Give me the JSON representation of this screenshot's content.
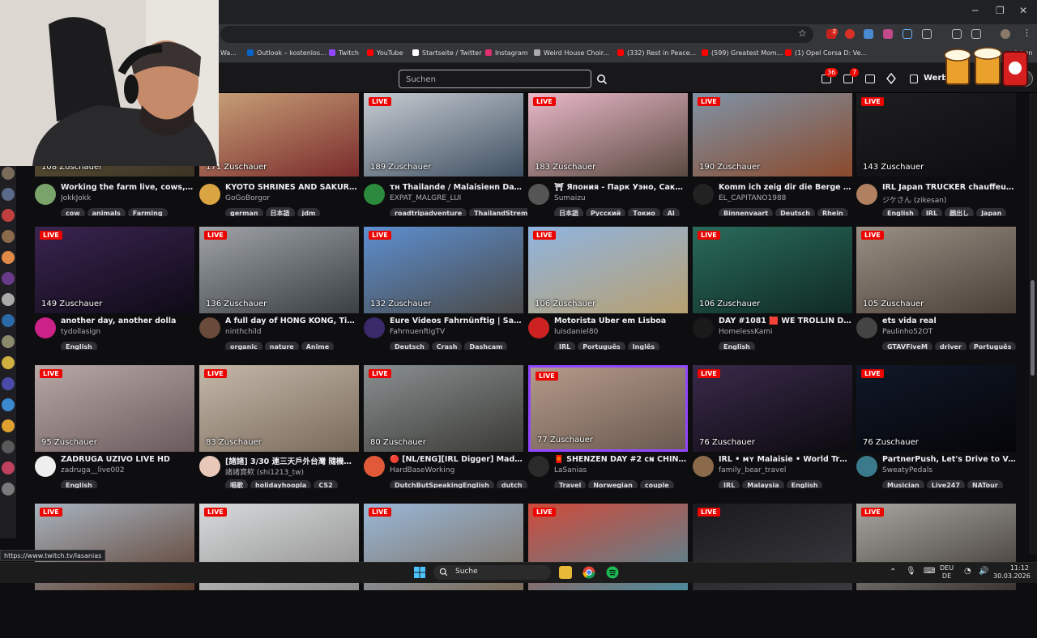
{
  "bookmarks": [
    {
      "label": "Wa...",
      "color": "#888888"
    },
    {
      "label": "Outlook – kostenlos...",
      "color": "#0a64c8"
    },
    {
      "label": "Twitch",
      "color": "#9147ff"
    },
    {
      "label": "YouTube",
      "color": "#ff0000"
    },
    {
      "label": "Startseite / Twitter",
      "color": "#ffffff"
    },
    {
      "label": "Instagram",
      "color": "#e1306c"
    },
    {
      "label": "Weird House Choir...",
      "color": "#aaaaaa"
    },
    {
      "label": "(332) Rest in Peace...",
      "color": "#ff0000"
    },
    {
      "label": "(599) Greatest Mom...",
      "color": "#ff0000"
    },
    {
      "label": "(1) Opel Corsa D: Ve...",
      "color": "#ff0000"
    },
    {
      "label": "...zeichen",
      "color": "#dcdcdc"
    }
  ],
  "extensions": {
    "badge1": "2",
    "badge2": ""
  },
  "topnav": {
    "search_placeholder": "Suchen",
    "notif_count_1": "36",
    "notif_count_2": "7",
    "werbung_label": "Werb"
  },
  "streams": [
    {
      "live": "",
      "viewers": "108 Zuschauer",
      "title": "Working the farm live, cows, shee...",
      "channel": "JokkJokk",
      "tags": [
        "cow",
        "animals",
        "Farming"
      ],
      "thumb": [
        "#6b6040",
        "#3c3324"
      ],
      "avatar": "#7aa36b"
    },
    {
      "live": "",
      "viewers": "171 Zuschauer",
      "title": "KYOTO SHRINES AND SAKURA | It...",
      "channel": "GoGoBorgor",
      "tags": [
        "german",
        "日本語",
        "jdm"
      ],
      "thumb": [
        "#c9a37a",
        "#7a2b2b"
      ],
      "avatar": "#d9a441"
    },
    {
      "live": "LIVE",
      "viewers": "189 Zuschauer",
      "title": "τн Thailande / Malaisieнn Day 12th ...",
      "channel": "EXPAT_MALGRE_LUI",
      "tags": [
        "roadtripadventure",
        "ThailandStremer"
      ],
      "thumb": [
        "#c7ccd2",
        "#3e4f61"
      ],
      "avatar": "#2b8a3e"
    },
    {
      "live": "LIVE",
      "viewers": "183 Zuschauer",
      "title": "⛩ Япония - Парк Уэно, Сакура, ...",
      "channel": "Sumaizu",
      "tags": [
        "日本語",
        "Русский",
        "Токио",
        "AI"
      ],
      "thumb": [
        "#e9b9c9",
        "#5a4a40"
      ],
      "avatar": "#555555"
    },
    {
      "live": "LIVE",
      "viewers": "190 Zuschauer",
      "title": "Komm ich zeig dir die Berge // !me...",
      "channel": "EL_CAPITANO1988",
      "tags": [
        "Binnenvaart",
        "Deutsch",
        "Rhein"
      ],
      "thumb": [
        "#7f93a6",
        "#8a4a2c"
      ],
      "avatar": "#222222"
    },
    {
      "live": "LIVE",
      "viewers": "143 Zuschauer",
      "title": "IRL Japan TRUCKER chauffeur de ...",
      "channel": "ジケさん (zikesan)",
      "tags": [
        "English",
        "IRL",
        "顔出し",
        "Japan"
      ],
      "thumb": [
        "#1e1e20",
        "#0d0d0f"
      ],
      "avatar": "#b08060"
    },
    {
      "live": "LIVE",
      "viewers": "149 Zuschauer",
      "title": "another day, another dolla",
      "channel": "tydollasign",
      "tags": [
        "English"
      ],
      "thumb": [
        "#3b2450",
        "#0e0a16"
      ],
      "avatar": "#cc2288"
    },
    {
      "live": "LIVE",
      "viewers": "136 Zuschauer",
      "title": "A full day of HONG KONG, TianTia...",
      "channel": "ninthchild",
      "tags": [
        "organic",
        "nature",
        "Anime"
      ],
      "thumb": [
        "#9fa3a7",
        "#3a3f44"
      ],
      "avatar": "#6a4a3a"
    },
    {
      "live": "LIVE",
      "viewers": "132 Zuschauer",
      "title": "Eure Videos Fahrnünftig | Sascha ...",
      "channel": "FahrnuenftigTV",
      "tags": [
        "Deutsch",
        "Crash",
        "Dashcam"
      ],
      "thumb": [
        "#5d8fd0",
        "#4a4a48"
      ],
      "avatar": "#3a2a6a"
    },
    {
      "live": "LIVE",
      "viewers": "106 Zuschauer",
      "title": "Motorista Uber em Lisboa",
      "channel": "luisdaniel80",
      "tags": [
        "IRL",
        "Português",
        "Inglês"
      ],
      "thumb": [
        "#8fb4e0",
        "#b8a070"
      ],
      "avatar": "#cc2222"
    },
    {
      "live": "LIVE",
      "viewers": "106 Zuschauer",
      "title": "DAY #1081 🟥 WE TROLLIN DA TR...",
      "channel": "HomelessKami",
      "tags": [
        "English"
      ],
      "thumb": [
        "#2a6b5c",
        "#0f2a24"
      ],
      "avatar": "#1a1a1a"
    },
    {
      "live": "LIVE",
      "viewers": "105 Zuschauer",
      "title": "ets vida real",
      "channel": "Paulinho52OT",
      "tags": [
        "GTAVFiveM",
        "driver",
        "Português"
      ],
      "thumb": [
        "#9a8f84",
        "#4a4038"
      ],
      "avatar": "#444444"
    },
    {
      "live": "LIVE",
      "viewers": "95 Zuschauer",
      "title": "ZADRUGA UZIVO LIVE HD",
      "channel": "zadruga__live002",
      "tags": [
        "English"
      ],
      "thumb": [
        "#b7a8a6",
        "#6b5a5c"
      ],
      "avatar": "#eeeeee"
    },
    {
      "live": "LIVE",
      "viewers": "83 Zuschauer",
      "title": "[諸諸] 3/30 連三天戶外台灣 隨機了...",
      "channel": "諸諸寶欸 (shi1213_tw)",
      "tags": [
        "唱歌",
        "holidayhoopla",
        "CS2"
      ],
      "thumb": [
        "#c4b8aa",
        "#7a6a5a"
      ],
      "avatar": "#e8c8b8"
    },
    {
      "live": "LIVE",
      "viewers": "80 Zuschauer",
      "title": "🔴 [NL/ENG][IRL Digger] Madness ...",
      "channel": "HardBaseWorking",
      "tags": [
        "DutchButSpeakingEnglish",
        "dutch"
      ],
      "thumb": [
        "#8a8f90",
        "#3a3a36"
      ],
      "avatar": "#e05a3a"
    },
    {
      "live": "LIVE",
      "viewers": "77 Zuschauer",
      "title": "🧧 SHENZEN DAY #2 cɴ CHINA IRL...",
      "channel": "LaSanias",
      "tags": [
        "Travel",
        "Norwegian",
        "couple"
      ],
      "thumb": [
        "#b49a8a",
        "#6a5a50"
      ],
      "avatar": "#2a2a2a"
    },
    {
      "live": "LIVE",
      "viewers": "76 Zuschauer",
      "title": "IRL • ᴍʏ Malaisie • World Travel • K...",
      "channel": "family_bear_travel",
      "tags": [
        "IRL",
        "Malaysia",
        "English"
      ],
      "thumb": [
        "#3a2a4a",
        "#0c0a10"
      ],
      "avatar": "#8a6a4a"
    },
    {
      "live": "LIVE",
      "viewers": "76 Zuschauer",
      "title": "PartnerPush, Let's Drive to Vegas ...",
      "channel": "SweatyPedals",
      "tags": [
        "Musician",
        "Live247",
        "NATour"
      ],
      "thumb": [
        "#101828",
        "#050508"
      ],
      "avatar": "#3a7a8a"
    },
    {
      "live": "LIVE",
      "viewers": "",
      "title": "",
      "channel": "",
      "tags": [],
      "thumb": [
        "#a8b4c0",
        "#5a3a2a"
      ],
      "avatar": "#000000"
    },
    {
      "live": "LIVE",
      "viewers": "",
      "title": "",
      "channel": "",
      "tags": [],
      "thumb": [
        "#d8dadc",
        "#8a8a88"
      ],
      "avatar": "#000000"
    },
    {
      "live": "LIVE",
      "viewers": "",
      "title": "",
      "channel": "",
      "tags": [],
      "thumb": [
        "#9ab8d8",
        "#7a6a58"
      ],
      "avatar": "#000000"
    },
    {
      "live": "LIVE",
      "viewers": "",
      "title": "",
      "channel": "",
      "tags": [],
      "thumb": [
        "#d04a3a",
        "#4a8a9a"
      ],
      "avatar": "#000000"
    },
    {
      "live": "LIVE",
      "viewers": "",
      "title": "",
      "channel": "",
      "tags": [],
      "thumb": [
        "#1a1a1e",
        "#3a3a40"
      ],
      "avatar": "#000000"
    },
    {
      "live": "LIVE",
      "viewers": "",
      "title": "",
      "channel": "",
      "tags": [],
      "thumb": [
        "#a8a6a0",
        "#3a3430"
      ],
      "avatar": "#000000"
    }
  ],
  "sidebar_avatars": [
    "#7a6a5a",
    "#5a6a8a",
    "#c04040",
    "#8a6a4a",
    "#e08a4a",
    "#6a3a8a",
    "#aaaaaa",
    "#2a6aa8",
    "#8a8a6a",
    "#d0b040",
    "#4a4aa8",
    "#3a8ad0",
    "#e0a030",
    "#5a5a5a",
    "#c04060",
    "#7a7a7a"
  ],
  "status_url": "https://www.twitch.tv/lasanias",
  "taskbar": {
    "search_label": "Suche",
    "lang_top": "DEU",
    "lang_bottom": "DE",
    "time": "11:12",
    "date": "30.03.2026"
  },
  "colors": {
    "accent": "#9147ff",
    "live": "#eb0400",
    "bg": "#0e0e10"
  }
}
